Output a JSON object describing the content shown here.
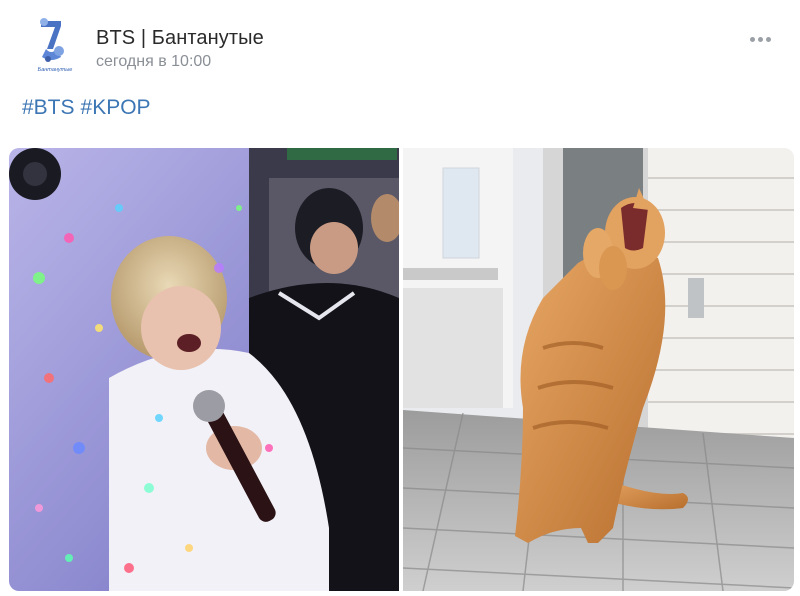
{
  "post": {
    "author": "BTS | Бантанутые",
    "time": "сегодня в 10:00",
    "hashtags": [
      "#BTS",
      "#KPOP"
    ]
  },
  "avatar": {
    "caption": "Бантанутые"
  },
  "colors": {
    "hashtag": "#3c76b4",
    "time": "#8a8f96",
    "author": "#2a2a2a"
  },
  "icons": {
    "menu": "more-horizontal-icon"
  }
}
